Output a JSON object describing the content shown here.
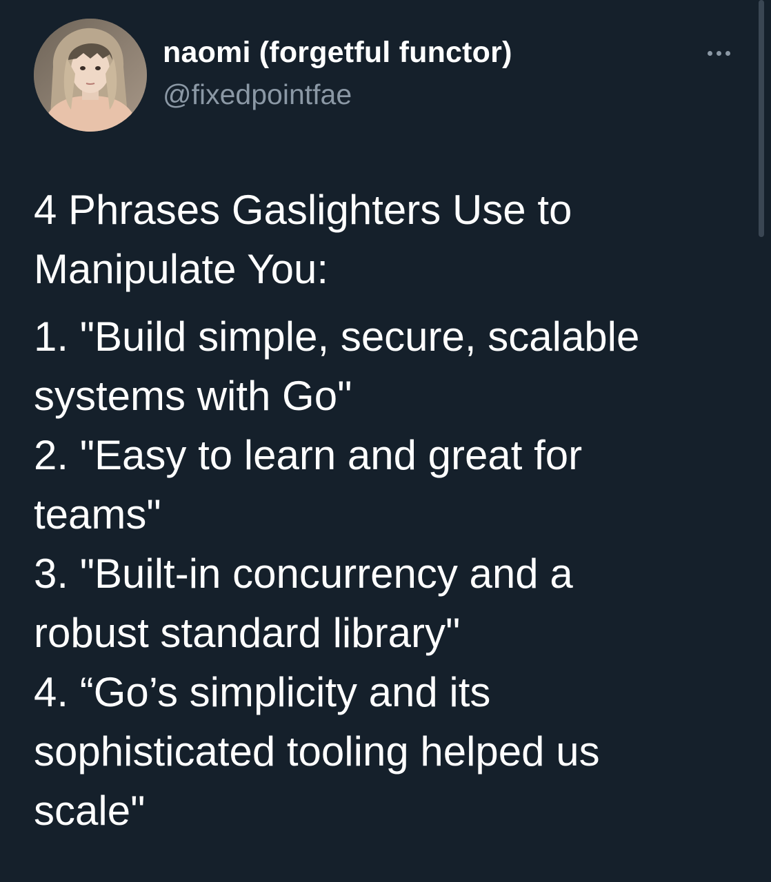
{
  "tweet": {
    "display_name": "naomi (forgetful functor)",
    "handle": "@fixedpointfae",
    "more_icon": "more-horizontal-icon",
    "avatar_icon": "profile-photo",
    "text_lines": [
      "4 Phrases Gaslighters Use to",
      "Manipulate You:",
      "1. \"Build simple, secure, scalable",
      "systems with Go\"",
      "2. \"Easy to learn and great for",
      "teams\"",
      "3. \"Built-in concurrency and a",
      "robust standard library\"",
      "4. “Go’s simplicity and its",
      "sophisticated tooling helped us",
      "scale\""
    ]
  },
  "colors": {
    "background": "#15202b",
    "primary_text": "#ffffff",
    "secondary_text": "#8b98a5"
  }
}
